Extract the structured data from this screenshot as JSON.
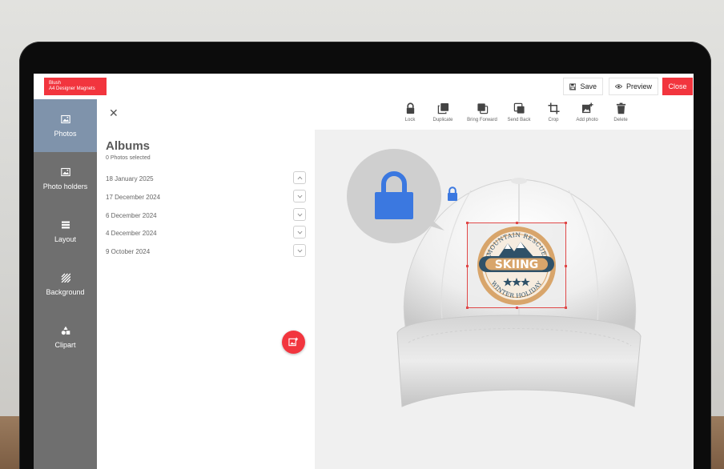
{
  "brand": {
    "line1": "Blush",
    "line2": "A4 Designer Magnets"
  },
  "header": {
    "save_label": "Save",
    "preview_label": "Preview",
    "close_label": "Close"
  },
  "sidebar": {
    "items": [
      {
        "label": "Photos",
        "icon": "image-icon",
        "active": true
      },
      {
        "label": "Photo holders",
        "icon": "image-icon",
        "active": false
      },
      {
        "label": "Layout",
        "icon": "layout-icon",
        "active": false
      },
      {
        "label": "Background",
        "icon": "stripes-icon",
        "active": false
      },
      {
        "label": "Clipart",
        "icon": "shapes-icon",
        "active": false
      }
    ]
  },
  "panel": {
    "close_glyph": "✕",
    "title": "Albums",
    "subtitle": "0 Photos selected",
    "albums": [
      {
        "label": "18 January 2025",
        "expanded": true
      },
      {
        "label": "17 December 2024",
        "expanded": false
      },
      {
        "label": "6 December 2024",
        "expanded": false
      },
      {
        "label": "4 December 2024",
        "expanded": false
      },
      {
        "label": "9 October 2024",
        "expanded": false
      }
    ]
  },
  "toolbar": {
    "tools": [
      {
        "label": "Lock",
        "icon": "lock-icon"
      },
      {
        "label": "Duplicate",
        "icon": "duplicate-icon"
      },
      {
        "label": "Bring Forward",
        "icon": "bring-forward-icon"
      },
      {
        "label": "Send Back",
        "icon": "send-back-icon"
      },
      {
        "label": "Crop",
        "icon": "crop-icon"
      },
      {
        "label": "Add photo",
        "icon": "add-photo-icon"
      },
      {
        "label": "Delete",
        "icon": "trash-icon"
      }
    ]
  },
  "logo": {
    "top_text": "MOUNTAIN RESCUE",
    "main_text": "SKIING",
    "bottom_text": "WINTER HOLIDAY"
  },
  "colors": {
    "accent_red": "#f2353e",
    "active_nav": "#7f93ab",
    "sidebar_gray": "#6f6f6f",
    "lock_blue": "#3b78e0"
  }
}
